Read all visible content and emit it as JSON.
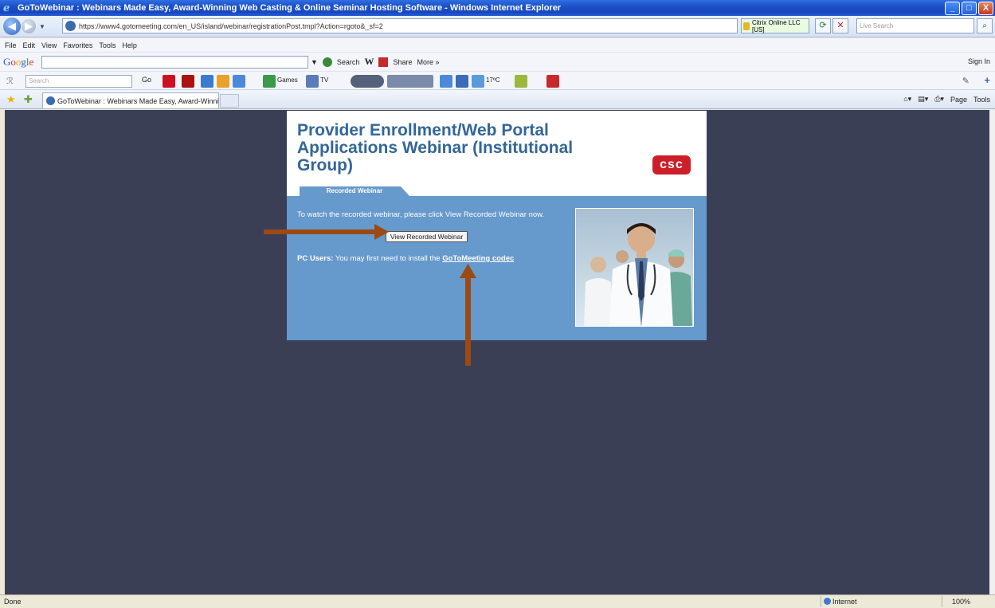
{
  "window": {
    "title": "GoToWebinar : Webinars Made Easy, Award-Winning Web Casting & Online Seminar Hosting Software - Windows Internet Explorer",
    "buttons": {
      "minimize": "_",
      "maximize": "□",
      "close": "X"
    }
  },
  "address": {
    "url": "https://www4.gotomeeting.com/en_US/island/webinar/registrationPost.tmpl?Action=rgoto&_sf=2",
    "security": "Citrix Online LLC [US]",
    "live_search_placeholder": "Live Search"
  },
  "menu": [
    "File",
    "Edit",
    "View",
    "Favorites",
    "Tools",
    "Help"
  ],
  "google_bar": {
    "logo": "Google",
    "search_label": "Search",
    "share_label": "Share",
    "more_label": "More »",
    "sign_in": "Sign In"
  },
  "toolbar2": {
    "search_placeholder": "Search",
    "go_label": "Go",
    "games_label": "Games",
    "tv_label": "TV",
    "temp_label": "17ºC"
  },
  "tab": {
    "label": "GoToWebinar : Webinars Made Easy, Award-Winning ...",
    "command_bar": {
      "page": "Page",
      "tools": "Tools"
    }
  },
  "page": {
    "title": "Provider Enrollment/Web Portal Applications Webinar (Institutional Group)",
    "logo": "csc",
    "tab_label": "Recorded Webinar",
    "instruction": "To watch the recorded webinar, please click View Recorded Webinar now.",
    "button_label": "View Recorded Webinar",
    "pc_users_label": "PC Users:",
    "pc_users_text": "You may first need to install the",
    "codec_link": "GoToMeeting codec",
    "annotation_color": "#9a4a12"
  },
  "status": {
    "text": "Done",
    "zone": "Internet",
    "zoom": "100%"
  }
}
